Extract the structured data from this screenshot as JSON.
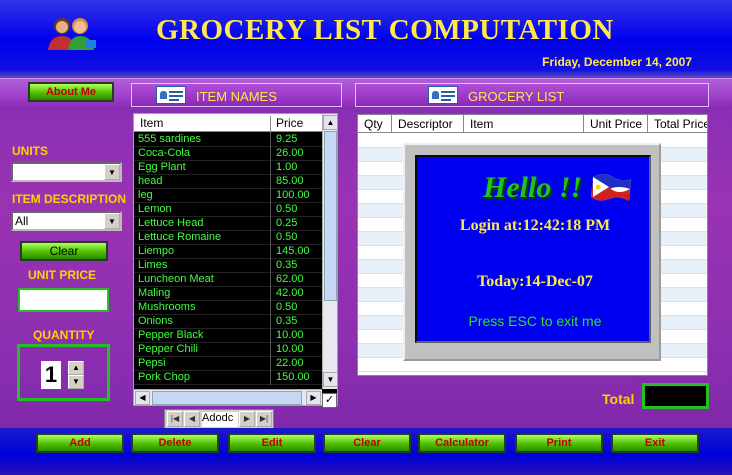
{
  "header": {
    "title": "GROCERY LIST COMPUTATION",
    "date": "Friday, December 14, 2007"
  },
  "about_button": "About Me",
  "sections": {
    "item_names": "ITEM NAMES",
    "grocery_list": "GROCERY LIST"
  },
  "left_panel": {
    "units_label": "UNITS",
    "units_value": "",
    "item_description_label": "ITEM DESCRIPTION",
    "item_description_value": "All",
    "clear_button": "Clear",
    "unit_price_label": "UNIT PRICE",
    "unit_price_value": "",
    "quantity_label": "QUANTITY",
    "quantity_value": "1"
  },
  "item_grid": {
    "columns": [
      "Item",
      "Price"
    ],
    "rows": [
      [
        "555 sardines",
        "9.25"
      ],
      [
        "Coca-Cola",
        "26.00"
      ],
      [
        "Egg Plant",
        "1.00"
      ],
      [
        "head",
        "85.00"
      ],
      [
        "leg",
        "100.00"
      ],
      [
        "Lemon",
        "0.50"
      ],
      [
        "Lettuce Head",
        "0.25"
      ],
      [
        "Lettuce Romaine",
        "0.50"
      ],
      [
        "Liempo",
        "145.00"
      ],
      [
        "Limes",
        "0.35"
      ],
      [
        "Luncheon Meat",
        "62.00"
      ],
      [
        "Maling",
        "42.00"
      ],
      [
        "Mushrooms",
        "0.50"
      ],
      [
        "Onions",
        "0.35"
      ],
      [
        "Pepper Black",
        "10.00"
      ],
      [
        "Pepper Chili",
        "10.00"
      ],
      [
        "Pepsi",
        "22.00"
      ],
      [
        "Pork Chop",
        "150.00"
      ]
    ]
  },
  "navigator": {
    "caption": "Adodc"
  },
  "grocery_grid": {
    "columns": [
      "Qty",
      "Descriptor",
      "Item",
      "Unit Price",
      "Total Price"
    ]
  },
  "splash": {
    "hello": "Hello !!",
    "login": "Login at:12:42:18 PM",
    "today": "Today:14-Dec-07",
    "esc": "Press ESC to exit me"
  },
  "total": {
    "label": "Total",
    "value": ""
  },
  "buttons": {
    "add": "Add",
    "delete": "Delete",
    "edit": "Edit",
    "clear": "Clear",
    "calculator": "Calculator",
    "print": "Print",
    "exit": "Exit"
  },
  "icons": {
    "logo": "users-icon",
    "section": "list-card-icon"
  },
  "colors": {
    "title": "#ffe94a",
    "grid_text": "#40ff40",
    "button_text": "#c00000",
    "accent_green": "#22c022"
  }
}
